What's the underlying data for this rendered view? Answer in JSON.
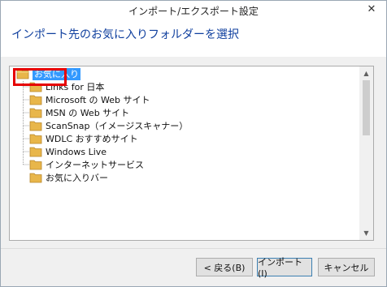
{
  "window": {
    "title": "インポート/エクスポート設定",
    "close_glyph": "✕"
  },
  "header": {
    "heading": "インポート先のお気に入りフォルダーを選択"
  },
  "tree": {
    "root": {
      "label": "お気に入り",
      "selected": true,
      "icon": "folder-open-icon"
    },
    "children": [
      {
        "label": "Links for 日本",
        "icon": "folder-icon"
      },
      {
        "label": "Microsoft の Web サイト",
        "icon": "folder-icon"
      },
      {
        "label": "MSN の Web サイト",
        "icon": "folder-icon"
      },
      {
        "label": "ScanSnap（イメージスキャナー）",
        "icon": "folder-icon"
      },
      {
        "label": "WDLC おすすめサイト",
        "icon": "folder-icon"
      },
      {
        "label": "Windows Live",
        "icon": "folder-icon"
      },
      {
        "label": "インターネットサービス",
        "icon": "folder-icon"
      },
      {
        "label": "お気に入りバー",
        "icon": "folder-icon"
      }
    ]
  },
  "scrollbar": {
    "up_glyph": "▲",
    "down_glyph": "▼"
  },
  "buttons": {
    "back": "< 戻る(B)",
    "import": "インポート(I)",
    "cancel": "キャンセル"
  },
  "colors": {
    "heading": "#0f3f9e",
    "selection": "#3399ff",
    "highlight_outline": "#e60000",
    "folder": "#e8b64a"
  }
}
